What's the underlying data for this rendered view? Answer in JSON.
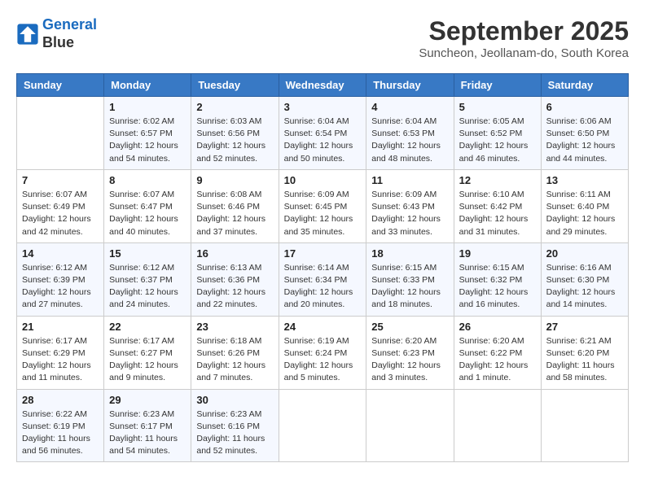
{
  "header": {
    "logo_line1": "General",
    "logo_line2": "Blue",
    "month": "September 2025",
    "location": "Suncheon, Jeollanam-do, South Korea"
  },
  "days_of_week": [
    "Sunday",
    "Monday",
    "Tuesday",
    "Wednesday",
    "Thursday",
    "Friday",
    "Saturday"
  ],
  "weeks": [
    [
      {
        "day": "",
        "info": ""
      },
      {
        "day": "1",
        "info": "Sunrise: 6:02 AM\nSunset: 6:57 PM\nDaylight: 12 hours\nand 54 minutes."
      },
      {
        "day": "2",
        "info": "Sunrise: 6:03 AM\nSunset: 6:56 PM\nDaylight: 12 hours\nand 52 minutes."
      },
      {
        "day": "3",
        "info": "Sunrise: 6:04 AM\nSunset: 6:54 PM\nDaylight: 12 hours\nand 50 minutes."
      },
      {
        "day": "4",
        "info": "Sunrise: 6:04 AM\nSunset: 6:53 PM\nDaylight: 12 hours\nand 48 minutes."
      },
      {
        "day": "5",
        "info": "Sunrise: 6:05 AM\nSunset: 6:52 PM\nDaylight: 12 hours\nand 46 minutes."
      },
      {
        "day": "6",
        "info": "Sunrise: 6:06 AM\nSunset: 6:50 PM\nDaylight: 12 hours\nand 44 minutes."
      }
    ],
    [
      {
        "day": "7",
        "info": "Sunrise: 6:07 AM\nSunset: 6:49 PM\nDaylight: 12 hours\nand 42 minutes."
      },
      {
        "day": "8",
        "info": "Sunrise: 6:07 AM\nSunset: 6:47 PM\nDaylight: 12 hours\nand 40 minutes."
      },
      {
        "day": "9",
        "info": "Sunrise: 6:08 AM\nSunset: 6:46 PM\nDaylight: 12 hours\nand 37 minutes."
      },
      {
        "day": "10",
        "info": "Sunrise: 6:09 AM\nSunset: 6:45 PM\nDaylight: 12 hours\nand 35 minutes."
      },
      {
        "day": "11",
        "info": "Sunrise: 6:09 AM\nSunset: 6:43 PM\nDaylight: 12 hours\nand 33 minutes."
      },
      {
        "day": "12",
        "info": "Sunrise: 6:10 AM\nSunset: 6:42 PM\nDaylight: 12 hours\nand 31 minutes."
      },
      {
        "day": "13",
        "info": "Sunrise: 6:11 AM\nSunset: 6:40 PM\nDaylight: 12 hours\nand 29 minutes."
      }
    ],
    [
      {
        "day": "14",
        "info": "Sunrise: 6:12 AM\nSunset: 6:39 PM\nDaylight: 12 hours\nand 27 minutes."
      },
      {
        "day": "15",
        "info": "Sunrise: 6:12 AM\nSunset: 6:37 PM\nDaylight: 12 hours\nand 24 minutes."
      },
      {
        "day": "16",
        "info": "Sunrise: 6:13 AM\nSunset: 6:36 PM\nDaylight: 12 hours\nand 22 minutes."
      },
      {
        "day": "17",
        "info": "Sunrise: 6:14 AM\nSunset: 6:34 PM\nDaylight: 12 hours\nand 20 minutes."
      },
      {
        "day": "18",
        "info": "Sunrise: 6:15 AM\nSunset: 6:33 PM\nDaylight: 12 hours\nand 18 minutes."
      },
      {
        "day": "19",
        "info": "Sunrise: 6:15 AM\nSunset: 6:32 PM\nDaylight: 12 hours\nand 16 minutes."
      },
      {
        "day": "20",
        "info": "Sunrise: 6:16 AM\nSunset: 6:30 PM\nDaylight: 12 hours\nand 14 minutes."
      }
    ],
    [
      {
        "day": "21",
        "info": "Sunrise: 6:17 AM\nSunset: 6:29 PM\nDaylight: 12 hours\nand 11 minutes."
      },
      {
        "day": "22",
        "info": "Sunrise: 6:17 AM\nSunset: 6:27 PM\nDaylight: 12 hours\nand 9 minutes."
      },
      {
        "day": "23",
        "info": "Sunrise: 6:18 AM\nSunset: 6:26 PM\nDaylight: 12 hours\nand 7 minutes."
      },
      {
        "day": "24",
        "info": "Sunrise: 6:19 AM\nSunset: 6:24 PM\nDaylight: 12 hours\nand 5 minutes."
      },
      {
        "day": "25",
        "info": "Sunrise: 6:20 AM\nSunset: 6:23 PM\nDaylight: 12 hours\nand 3 minutes."
      },
      {
        "day": "26",
        "info": "Sunrise: 6:20 AM\nSunset: 6:22 PM\nDaylight: 12 hours\nand 1 minute."
      },
      {
        "day": "27",
        "info": "Sunrise: 6:21 AM\nSunset: 6:20 PM\nDaylight: 11 hours\nand 58 minutes."
      }
    ],
    [
      {
        "day": "28",
        "info": "Sunrise: 6:22 AM\nSunset: 6:19 PM\nDaylight: 11 hours\nand 56 minutes."
      },
      {
        "day": "29",
        "info": "Sunrise: 6:23 AM\nSunset: 6:17 PM\nDaylight: 11 hours\nand 54 minutes."
      },
      {
        "day": "30",
        "info": "Sunrise: 6:23 AM\nSunset: 6:16 PM\nDaylight: 11 hours\nand 52 minutes."
      },
      {
        "day": "",
        "info": ""
      },
      {
        "day": "",
        "info": ""
      },
      {
        "day": "",
        "info": ""
      },
      {
        "day": "",
        "info": ""
      }
    ]
  ]
}
